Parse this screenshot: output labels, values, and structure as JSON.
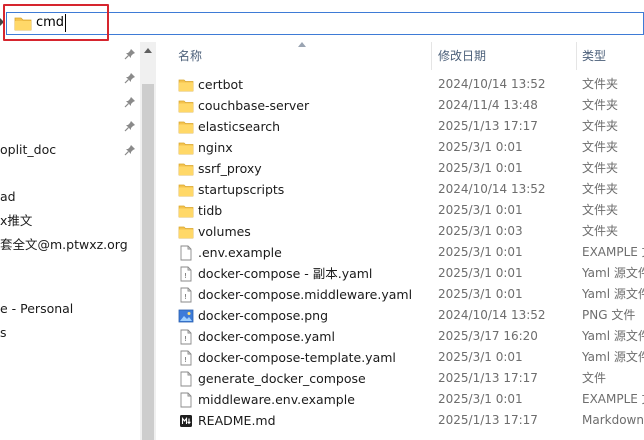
{
  "address_bar": {
    "path": "cmd"
  },
  "nav_pane": {
    "items": [
      {
        "label": "oplit_doc"
      },
      {
        "label": "ad"
      },
      {
        "label": "x推文"
      },
      {
        "label": "套全文@m.ptwxz.org"
      },
      {
        "label": "e - Personal"
      },
      {
        "label": "s"
      }
    ]
  },
  "columns": {
    "name": "名称",
    "date": "修改日期",
    "type": "类型"
  },
  "colors": {
    "accent": "#3e7bd6",
    "highlight_box": "#d6252e",
    "folder": "#f4c34e"
  },
  "files": [
    {
      "name": "certbot",
      "date": "2024/10/14 13:52",
      "type": "文件夹",
      "icon": "folder-icon"
    },
    {
      "name": "couchbase-server",
      "date": "2024/11/4 13:48",
      "type": "文件夹",
      "icon": "folder-icon"
    },
    {
      "name": "elasticsearch",
      "date": "2025/1/13 17:17",
      "type": "文件夹",
      "icon": "folder-icon"
    },
    {
      "name": "nginx",
      "date": "2025/3/1 0:01",
      "type": "文件夹",
      "icon": "folder-icon"
    },
    {
      "name": "ssrf_proxy",
      "date": "2025/3/1 0:01",
      "type": "文件夹",
      "icon": "folder-icon"
    },
    {
      "name": "startupscripts",
      "date": "2024/10/14 13:52",
      "type": "文件夹",
      "icon": "folder-icon"
    },
    {
      "name": "tidb",
      "date": "2025/3/1 0:01",
      "type": "文件夹",
      "icon": "folder-icon"
    },
    {
      "name": "volumes",
      "date": "2025/3/1 0:03",
      "type": "文件夹",
      "icon": "folder-icon"
    },
    {
      "name": ".env.example",
      "date": "2025/3/1 0:01",
      "type": "EXAMPLE 文",
      "icon": "file-icon"
    },
    {
      "name": "docker-compose - 副本.yaml",
      "date": "2025/3/1 0:01",
      "type": "Yaml 源文件",
      "icon": "yaml-file-icon"
    },
    {
      "name": "docker-compose.middleware.yaml",
      "date": "2025/3/1 0:01",
      "type": "Yaml 源文件",
      "icon": "yaml-file-icon"
    },
    {
      "name": "docker-compose.png",
      "date": "2024/10/14 13:52",
      "type": "PNG 文件",
      "icon": "image-file-icon"
    },
    {
      "name": "docker-compose.yaml",
      "date": "2025/3/17 16:20",
      "type": "Yaml 源文件",
      "icon": "yaml-file-icon"
    },
    {
      "name": "docker-compose-template.yaml",
      "date": "2025/3/1 0:01",
      "type": "Yaml 源文件",
      "icon": "yaml-file-icon"
    },
    {
      "name": "generate_docker_compose",
      "date": "2025/1/13 17:17",
      "type": "文件",
      "icon": "file-icon"
    },
    {
      "name": "middleware.env.example",
      "date": "2025/3/1 0:01",
      "type": "EXAMPLE 文",
      "icon": "file-icon"
    },
    {
      "name": "README.md",
      "date": "2025/1/13 17:17",
      "type": "Markdown",
      "icon": "markdown-file-icon"
    }
  ]
}
